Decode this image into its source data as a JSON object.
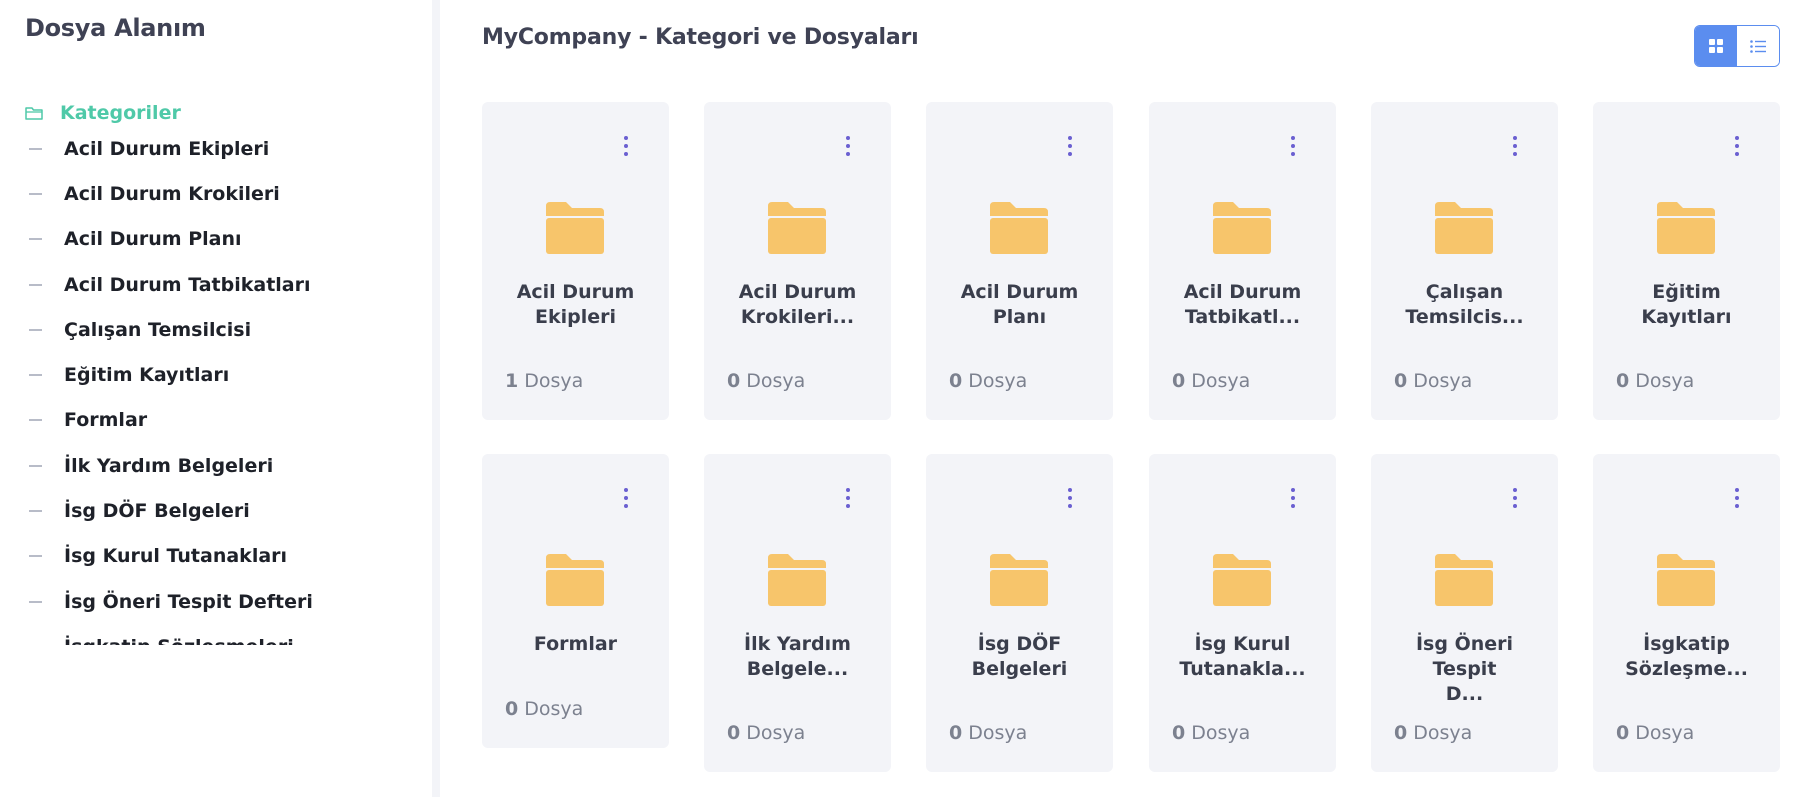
{
  "sidebar": {
    "title": "Dosya Alanım",
    "root_label": "Kategoriler",
    "items": [
      {
        "label": "Acil Durum Ekipleri"
      },
      {
        "label": "Acil Durum Krokileri"
      },
      {
        "label": "Acil Durum Planı"
      },
      {
        "label": "Acil Durum Tatbikatları"
      },
      {
        "label": "Çalışan Temsilcisi"
      },
      {
        "label": "Eğitim Kayıtları"
      },
      {
        "label": "Formlar"
      },
      {
        "label": "İlk Yardım Belgeleri"
      },
      {
        "label": "İsg DÖF Belgeleri"
      },
      {
        "label": "İsg Kurul Tutanakları"
      },
      {
        "label": "İsg Öneri Tespit Defteri"
      },
      {
        "label": "İsgkatip Sözleşmeleri"
      }
    ]
  },
  "header": {
    "title": "MyCompany - Kategori ve Dosyaları"
  },
  "view_toggle": {
    "grid_icon": "grid-icon",
    "list_icon": "list-icon",
    "active": "grid"
  },
  "folder_color": "#f7c56b",
  "accent_color": "#4fc9a8",
  "primary_color": "#5b8def",
  "cards": [
    {
      "name_line1": "Acil Durum",
      "name_line2": "Ekipleri",
      "count": "1",
      "unit": "Dosya"
    },
    {
      "name_line1": "Acil Durum",
      "name_line2": "Krokileri...",
      "count": "0",
      "unit": "Dosya"
    },
    {
      "name_line1": "Acil Durum",
      "name_line2": "Planı",
      "count": "0",
      "unit": "Dosya"
    },
    {
      "name_line1": "Acil Durum",
      "name_line2": "Tatbikatl...",
      "count": "0",
      "unit": "Dosya"
    },
    {
      "name_line1": "Çalışan",
      "name_line2": "Temsilcis...",
      "count": "0",
      "unit": "Dosya"
    },
    {
      "name_line1": "Eğitim",
      "name_line2": "Kayıtları",
      "count": "0",
      "unit": "Dosya"
    },
    {
      "name_line1": "Formlar",
      "name_line2": "",
      "count": "0",
      "unit": "Dosya"
    },
    {
      "name_line1": "İlk Yardım",
      "name_line2": "Belgele...",
      "count": "0",
      "unit": "Dosya"
    },
    {
      "name_line1": "İsg DÖF",
      "name_line2": "Belgeleri",
      "count": "0",
      "unit": "Dosya"
    },
    {
      "name_line1": "İsg Kurul",
      "name_line2": "Tutanakla...",
      "count": "0",
      "unit": "Dosya"
    },
    {
      "name_line1": "İsg Öneri Tespit",
      "name_line2": "D...",
      "count": "0",
      "unit": "Dosya"
    },
    {
      "name_line1": "İsgkatip",
      "name_line2": "Sözleşme...",
      "count": "0",
      "unit": "Dosya"
    }
  ]
}
